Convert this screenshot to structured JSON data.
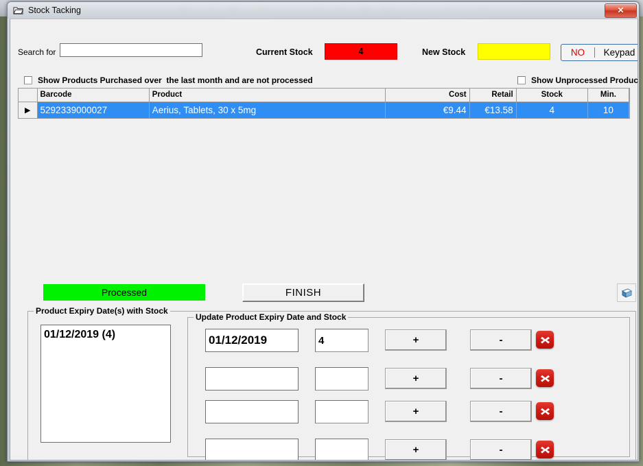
{
  "window": {
    "title": "Stock Tacking",
    "icon": "folder-icon",
    "close_label": "✕"
  },
  "toolbar": {
    "search_label": "Search for",
    "search_value": "",
    "search_placeholder": "",
    "current_stock_label": "Current Stock",
    "current_stock_value": "4",
    "current_stock_color": "#fe0000",
    "new_stock_label": "New Stock",
    "new_stock_value": "",
    "new_stock_color": "#ffff00",
    "keypad_state": "NO",
    "keypad_label": "Keypad",
    "keypad_state_color": "#d90000"
  },
  "filters": [
    {
      "name": "show-products-purchased-checkbox",
      "label": "Show Products Purchased over  the last month and are not processed",
      "checked": false
    },
    {
      "name": "show-unprocessed-products-checkbox",
      "label": "Show Unprocessed Products",
      "checked": false
    }
  ],
  "grid": {
    "columns": [
      "",
      "Barcode",
      "Product",
      "Cost",
      "Retail",
      "Stock",
      "Min."
    ],
    "rows": [
      {
        "selector": "▶",
        "barcode": "5292339000027",
        "product": "Aerius, Tablets, 30 x 5mg",
        "cost": "€9.44",
        "retail": "€13.58",
        "stock": "4",
        "min": "10",
        "selected": true
      }
    ],
    "selected_row_color": "#2f8ef4"
  },
  "status": {
    "processed_label": "Processed",
    "processed_color": "#00f200",
    "finish_label": "FINISH",
    "print_icon": "print-box-icon"
  },
  "expiry_group": {
    "title": "Product Expiry Date(s) with Stock",
    "items": [
      "01/12/2019 (4)"
    ]
  },
  "update_group": {
    "title": "Update Product Expiry Date and Stock",
    "plus_label": "+",
    "minus_label": "-",
    "delete_icon": "delete-x-icon",
    "rows": [
      {
        "date": "01/12/2019",
        "qty": "4"
      },
      {
        "date": "",
        "qty": ""
      },
      {
        "date": "",
        "qty": ""
      },
      {
        "date": "",
        "qty": ""
      }
    ]
  }
}
